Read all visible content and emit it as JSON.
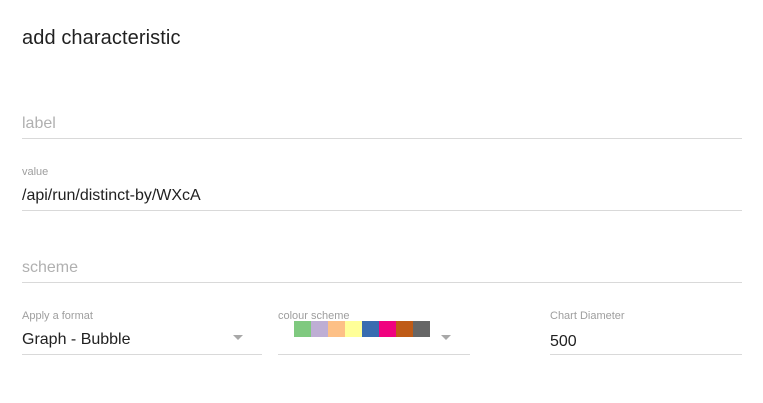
{
  "dialog": {
    "title": "add characteristic"
  },
  "label_field": {
    "placeholder": "label"
  },
  "value_field": {
    "label": "value",
    "value": "/api/run/distinct-by/WXcA"
  },
  "scheme_field": {
    "placeholder": "scheme"
  },
  "format_field": {
    "label": "Apply a format",
    "value": "Graph - Bubble"
  },
  "colour_scheme_field": {
    "label": "colour scheme",
    "swatches": [
      "#7fc97f",
      "#beaed4",
      "#fdc086",
      "#ffff99",
      "#386cb0",
      "#f0027f",
      "#bf5b17",
      "#666666"
    ]
  },
  "diameter_field": {
    "label": "Chart Diameter",
    "value": "500"
  }
}
